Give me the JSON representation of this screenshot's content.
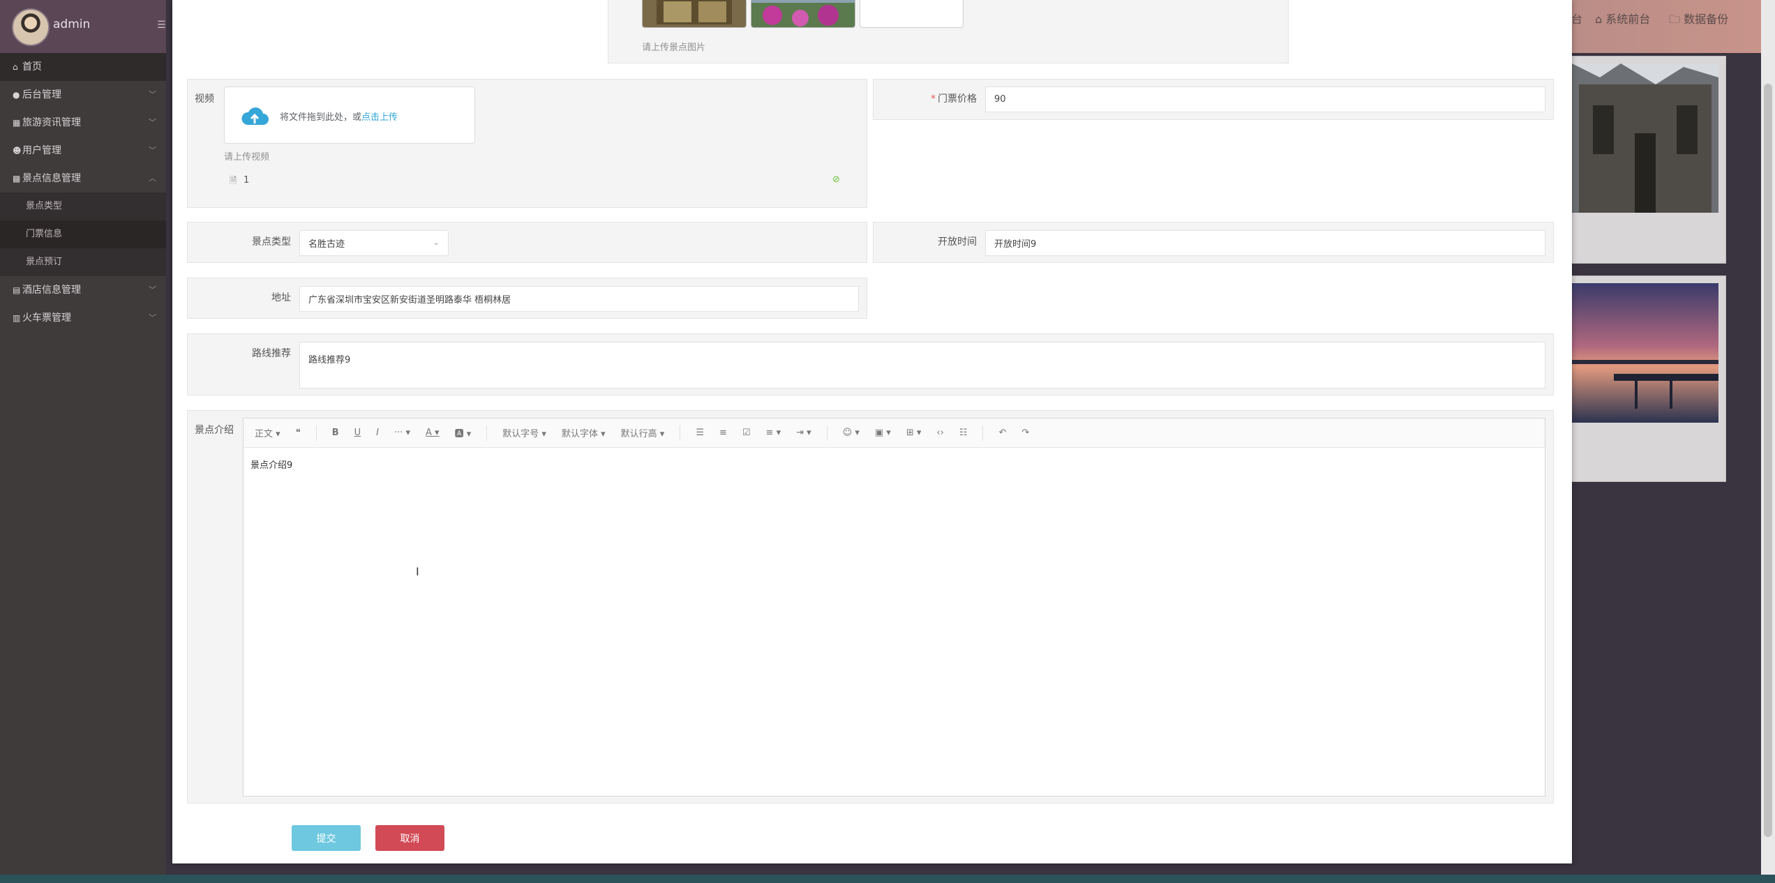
{
  "sidebar": {
    "user": "admin",
    "items": [
      {
        "label": "首页",
        "icon": "home-icon",
        "sub": false,
        "active": true,
        "chevron": ""
      },
      {
        "label": "后台管理",
        "icon": "settings-icon",
        "sub": false,
        "chevron": "down"
      },
      {
        "label": "旅游资讯管理",
        "icon": "news-icon",
        "sub": false,
        "chevron": "down"
      },
      {
        "label": "用户管理",
        "icon": "user-icon",
        "sub": false,
        "chevron": "down"
      },
      {
        "label": "景点信息管理",
        "icon": "scenic-icon",
        "sub": false,
        "chevron": "up"
      },
      {
        "label": "景点类型",
        "sub": true
      },
      {
        "label": "门票信息",
        "sub": true,
        "current": true
      },
      {
        "label": "景点预订",
        "sub": true
      },
      {
        "label": "酒店信息管理",
        "icon": "hotel-icon",
        "sub": false,
        "chevron": "down"
      },
      {
        "label": "火车票管理",
        "icon": "train-icon",
        "sub": false,
        "chevron": "down"
      }
    ]
  },
  "topnav": {
    "partial": "台",
    "front": "系统前台",
    "backup": "数据备份"
  },
  "form": {
    "image_hint": "请上传景点图片",
    "video_label": "视频",
    "upload_text": "将文件拖到此处，或",
    "upload_link": "点击上传",
    "video_hint": "请上传视频",
    "video_file": "1",
    "price_label": "门票价格",
    "price_value": "90",
    "type_label": "景点类型",
    "type_value": "名胜古迹",
    "open_label": "开放时间",
    "open_value": "开放时间9",
    "address_label": "地址",
    "address_value": "广东省深圳市宝安区新安街道圣明路泰华 梧桐林居",
    "route_label": "路线推荐",
    "route_value": "路线推荐9",
    "intro_label": "景点介绍",
    "intro_value": "景点介绍9"
  },
  "editor_toolbar": {
    "paragraph": "正文",
    "fontsize": "默认字号",
    "fontfamily": "默认字体",
    "lineheight": "默认行高"
  },
  "buttons": {
    "submit": "提交",
    "cancel": "取消"
  },
  "colors": {
    "submit": "#5bc0de",
    "cancel": "#d9534f",
    "link": "#2fa7d8",
    "sidebar": "#3f3b3b"
  }
}
